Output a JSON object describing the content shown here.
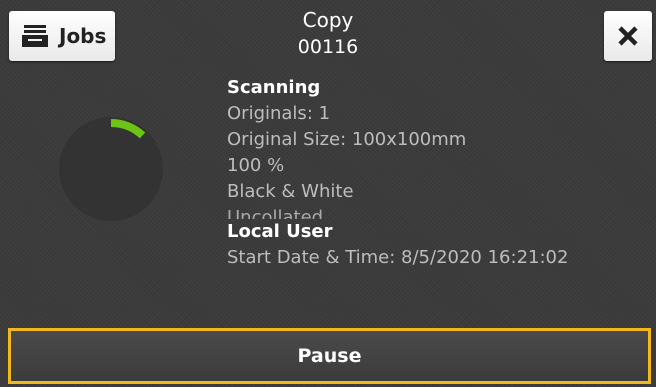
{
  "header": {
    "jobs_label": "Jobs",
    "title": "Copy",
    "job_number": "00116"
  },
  "icons": {
    "jobs": "jobs-tray-icon",
    "close": "close-icon"
  },
  "progress": {
    "value": 0.12,
    "track_color": "#333333",
    "arc_color": "#6cc417"
  },
  "details": {
    "status": "Scanning",
    "originals": "Originals: 1",
    "original_size": "Original Size: 100x100mm",
    "scale": "100 %",
    "color_mode": "Black & White",
    "collation": "Uncollated",
    "user": "Local User",
    "start_time": "Start Date & Time: 8/5/2020 16:21:02"
  },
  "footer": {
    "pause_label": "Pause",
    "highlight_color": "#f2b81c"
  }
}
